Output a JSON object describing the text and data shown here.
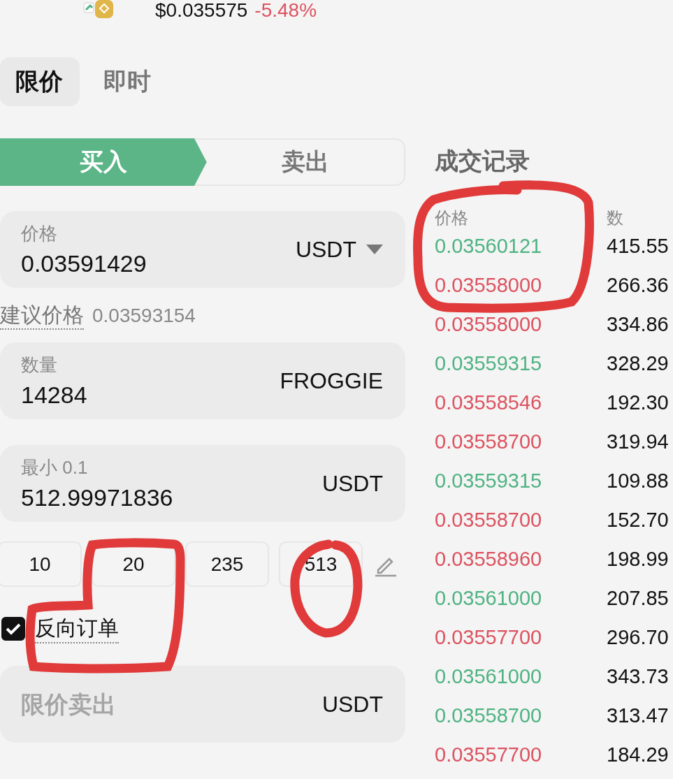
{
  "ticker": {
    "price": "$0.035575",
    "change": "-5.48%",
    "negative": true
  },
  "order_types": [
    {
      "label": "限价",
      "selected": true
    },
    {
      "label": "即时",
      "selected": false
    }
  ],
  "sides": [
    {
      "label": "买入",
      "selected": true
    },
    {
      "label": "卖出",
      "selected": false
    }
  ],
  "price_field": {
    "label": "价格",
    "value": "0.03591429",
    "unit": "USDT"
  },
  "suggested": {
    "label": "建议价格",
    "value": "0.03593154"
  },
  "amount_field": {
    "label": "数量",
    "value": "14284",
    "unit": "FROGGIE"
  },
  "total_field": {
    "label": "最小 0.1",
    "value": "512.99971836",
    "unit": "USDT"
  },
  "quick_amounts": [
    "10",
    "20",
    "235",
    "513"
  ],
  "reverse_order": {
    "label": "反向订单",
    "checked": true
  },
  "reverse_field": {
    "placeholder": "限价卖出",
    "unit": "USDT"
  },
  "trades": {
    "title": "成交记录",
    "columns": [
      "价格",
      "数"
    ],
    "rows": [
      {
        "price": "0.03560121",
        "amount": "415.55",
        "color": "#4fb382"
      },
      {
        "price": "0.03558000",
        "amount": "266.36",
        "color": "#dc5360"
      },
      {
        "price": "0.03558000",
        "amount": "334.86",
        "color": "#dc5360"
      },
      {
        "price": "0.03559315",
        "amount": "328.29",
        "color": "#4fb382"
      },
      {
        "price": "0.03558546",
        "amount": "192.30",
        "color": "#dc5360"
      },
      {
        "price": "0.03558700",
        "amount": "319.94",
        "color": "#dc5360"
      },
      {
        "price": "0.03559315",
        "amount": "109.88",
        "color": "#4fb382"
      },
      {
        "price": "0.03558700",
        "amount": "152.70",
        "color": "#dc5360"
      },
      {
        "price": "0.03558960",
        "amount": "198.99",
        "color": "#dc5360"
      },
      {
        "price": "0.03561000",
        "amount": "207.85",
        "color": "#4fb382"
      },
      {
        "price": "0.03557700",
        "amount": "296.70",
        "color": "#dc5360"
      },
      {
        "price": "0.03561000",
        "amount": "343.73",
        "color": "#4fb382"
      },
      {
        "price": "0.03558700",
        "amount": "313.47",
        "color": "#4fb382"
      },
      {
        "price": "0.03557700",
        "amount": "184.29",
        "color": "#dc5360"
      }
    ]
  }
}
